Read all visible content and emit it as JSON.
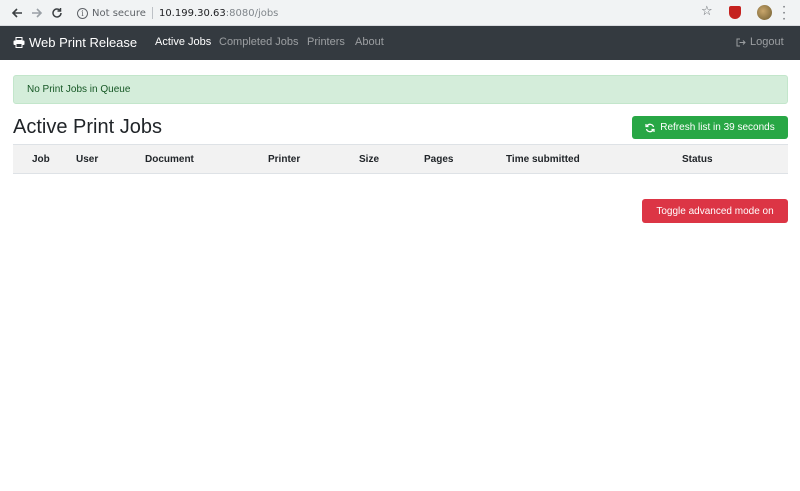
{
  "browser": {
    "security_label": "Not secure",
    "url_host": "10.199.30.63",
    "url_path": ":8080/jobs",
    "back_icon": "arrow-left-icon",
    "forward_icon": "arrow-right-icon",
    "reload_icon": "reload-icon",
    "star_icon": "star-icon",
    "menu_icon": "kebab-menu-icon"
  },
  "navbar": {
    "brand": "Web Print Release",
    "brand_icon": "printer-icon",
    "links": {
      "active_jobs": "Active Jobs",
      "completed_jobs": "Completed Jobs",
      "printers": "Printers",
      "about": "About"
    },
    "logout": "Logout",
    "logout_icon": "sign-out-icon",
    "background": "#343a40"
  },
  "alert": {
    "text": "No Print Jobs in Queue",
    "color": "#d4edda"
  },
  "main": {
    "title": "Active Print Jobs",
    "refresh_button": "Refresh list in 39 seconds",
    "refresh_icon": "refresh-icon",
    "toggle_button": "Toggle advanced mode on"
  },
  "table": {
    "columns": {
      "job": "Job",
      "user": "User",
      "document": "Document",
      "printer": "Printer",
      "size": "Size",
      "pages": "Pages",
      "time_submitted": "Time submitted",
      "status": "Status"
    },
    "rows": []
  },
  "colors": {
    "success": "#28a745",
    "danger": "#dc3545"
  }
}
